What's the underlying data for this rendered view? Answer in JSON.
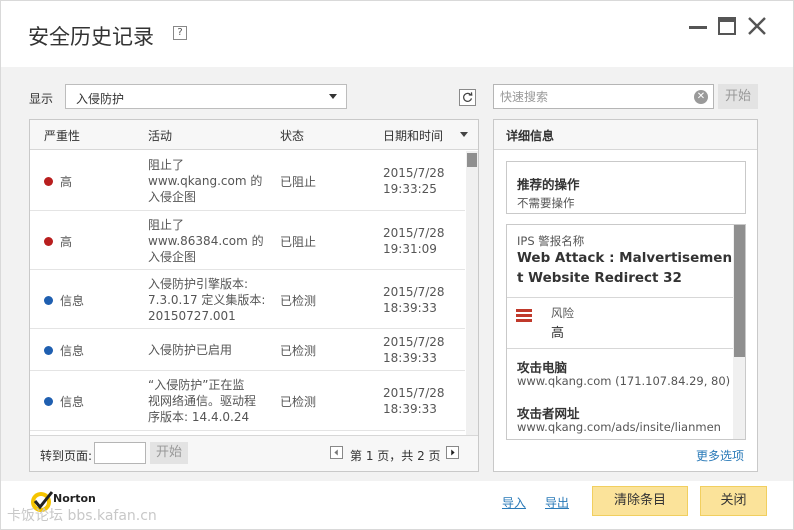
{
  "window": {
    "title": "安全历史记录",
    "help": "?"
  },
  "filter": {
    "label": "显示",
    "selected": "入侵防护"
  },
  "search": {
    "placeholder": "快速搜索",
    "value": "",
    "go_label": "开始"
  },
  "grid": {
    "columns": {
      "severity": "严重性",
      "activity": "活动",
      "status": "状态",
      "datetime": "日期和时间"
    },
    "rows": [
      {
        "severity": "高",
        "color": "#b81e1e",
        "activity": [
          "阻止了",
          "www.qkang.com 的",
          "入侵企图"
        ],
        "status": "已阻止",
        "date": "2015/7/28",
        "time": "19:33:25"
      },
      {
        "severity": "高",
        "color": "#b81e1e",
        "activity": [
          "阻止了",
          "www.86384.com 的",
          "入侵企图"
        ],
        "status": "已阻止",
        "date": "2015/7/28",
        "time": "19:31:09"
      },
      {
        "severity": "信息",
        "color": "#1f5fb0",
        "activity": [
          "入侵防护引擎版本:",
          "7.3.0.17 定义集版本:",
          "20150727.001"
        ],
        "status": "已检测",
        "date": "2015/7/28",
        "time": "18:39:33"
      },
      {
        "severity": "信息",
        "color": "#1f5fb0",
        "activity": [
          "入侵防护已启用"
        ],
        "status": "已检测",
        "date": "2015/7/28",
        "time": "18:39:33"
      },
      {
        "severity": "信息",
        "color": "#1f5fb0",
        "activity": [
          "“入侵防护”正在监",
          "视网络通信。驱动程",
          "序版本: 14.4.0.24"
        ],
        "status": "已检测",
        "date": "2015/7/28",
        "time": "18:39:33"
      }
    ]
  },
  "pager": {
    "goto_label": "转到页面:",
    "go_label": "开始",
    "page_info": "第 1 页，共 2 页"
  },
  "details": {
    "header": "详细信息",
    "recommend_title": "推荐的操作",
    "recommend_value": "不需要操作",
    "ips_label": "IPS 警报名称",
    "ips_name_line1": "Web Attack : Malvertisemen",
    "ips_name_line2": "t Website Redirect 32",
    "risk_label": "风险",
    "risk_value": "高",
    "attacker_pc_label": "攻击电脑",
    "attacker_pc_value": "www.qkang.com (171.107.84.29, 80)",
    "attacker_url_label": "攻击者网址",
    "attacker_url_value": "www.qkang.com/ads/insite/lianmen...",
    "more_options": "更多选项"
  },
  "footer": {
    "brand": "Norton",
    "watermark": "卡饭论坛 bbs.kafan.cn",
    "import": "导入",
    "export": "导出",
    "clear": "清除条目",
    "close": "关闭"
  }
}
